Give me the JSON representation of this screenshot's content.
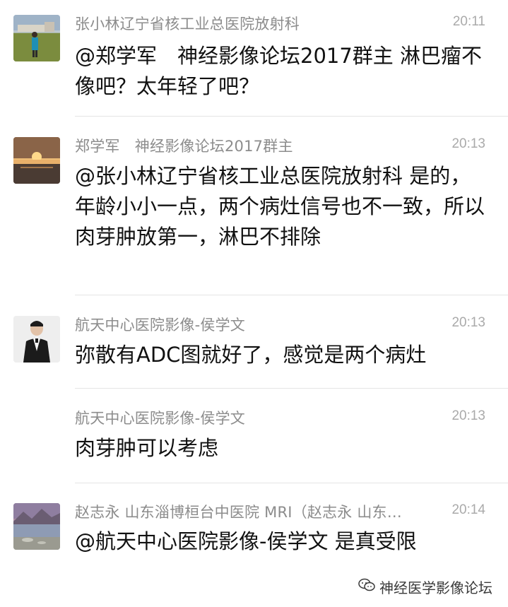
{
  "messages": [
    {
      "sender": "张小林辽宁省核工业总医院放射科",
      "time": "20:11",
      "text": "@郑学军　神经影像论坛2017群主 淋巴瘤不像吧？太年轻了吧？",
      "avatar": "person-outdoors-avatar"
    },
    {
      "sender": "郑学军　神经影像论坛2017群主",
      "time": "20:13",
      "text": "@张小林辽宁省核工业总医院放射科 是的，年龄小小一点，两个病灶信号也不一致，所以肉芽肿放第一，淋巴不排除",
      "avatar": "sunset-avatar"
    },
    {
      "sender": "航天中心医院影像-侯学文",
      "time": "20:13",
      "text": "弥散有ADC图就好了，感觉是两个病灶",
      "avatar": "man-in-suit-avatar"
    },
    {
      "sender": "航天中心医院影像-侯学文",
      "time": "20:13",
      "text": "肉芽肿可以考虑",
      "avatar": ""
    },
    {
      "sender": "赵志永 山东淄博桓台中医院 MRI（赵志永 山东…",
      "time": "20:14",
      "text": "@航天中心医院影像-侯学文 是真受限",
      "avatar": "lake-landscape-avatar"
    }
  ],
  "watermark": {
    "text": "神经医学影像论坛",
    "icon": "wechat-icon"
  }
}
